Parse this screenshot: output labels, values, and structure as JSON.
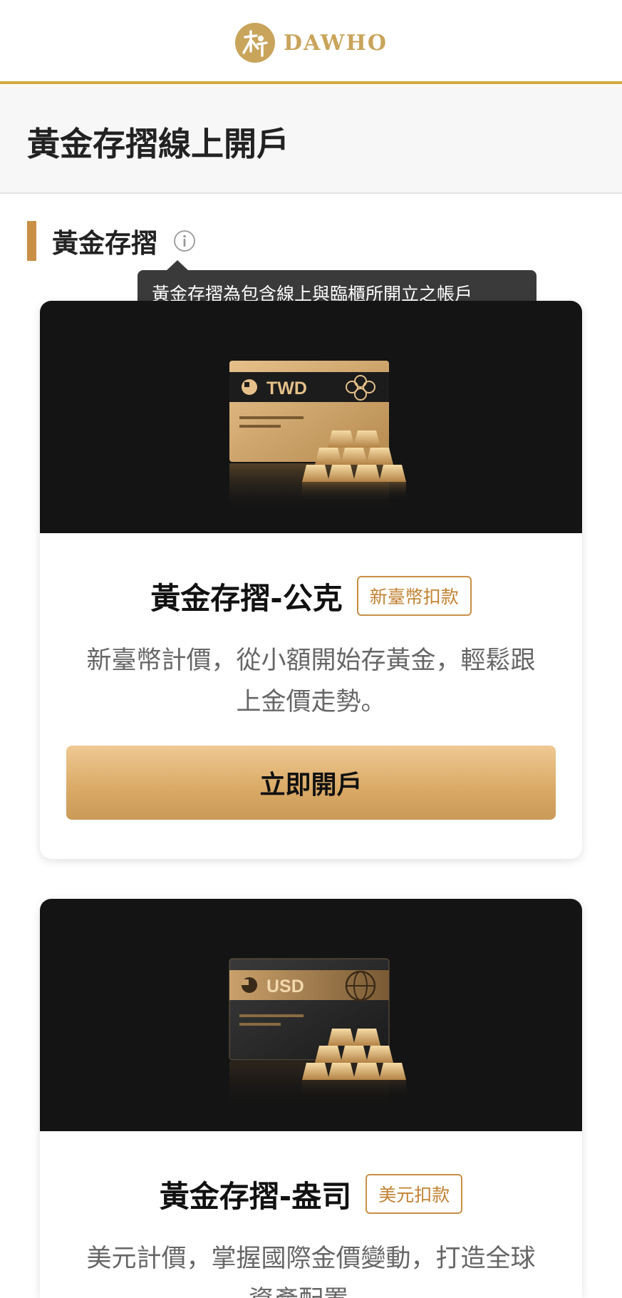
{
  "header": {
    "logo_text": "DAWHO",
    "brand_color": "#c9a45b",
    "accent_line_color": "#d4a93b"
  },
  "page": {
    "title": "黃金存摺線上開戶"
  },
  "section": {
    "title": "黃金存摺",
    "info_icon": "info-icon",
    "tooltip": "黃金存摺為包含線上與臨櫃所開立之帳戶"
  },
  "products": [
    {
      "card_currency": "TWD",
      "name": "黃金存摺-公克",
      "badge": "新臺幣扣款",
      "description": "新臺幣計價，從小額開始存黃金，輕鬆跟上金價走勢。",
      "button": "立即開戶"
    },
    {
      "card_currency": "USD",
      "name": "黃金存摺-盎司",
      "badge": "美元扣款",
      "description": "美元計價，掌握國際金價變動，打造全球資產配置。"
    }
  ]
}
